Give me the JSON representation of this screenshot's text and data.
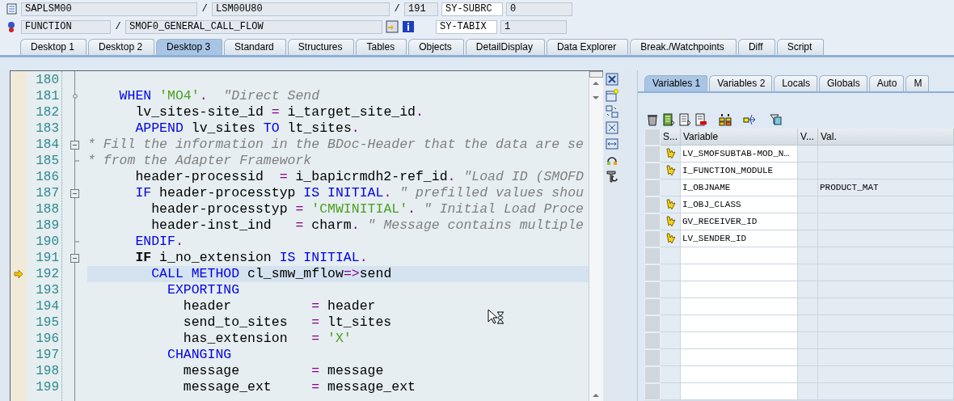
{
  "header": {
    "row_1": {
      "program": "SAPLSM00",
      "sep_1": "/",
      "include": "LSM00U80",
      "sep_2": "/",
      "line": "191",
      "sys_field": "SY-SUBRC",
      "sys_value": "0"
    },
    "row_2": {
      "type": "FUNCTION",
      "sep": "/",
      "name": "SMOF0_GENERAL_CALL_FLOW",
      "sys_field": "SY-TABIX",
      "sys_value": "1"
    }
  },
  "tabs": [
    {
      "label": "Desktop 1",
      "selected": false
    },
    {
      "label": "Desktop 2",
      "selected": false
    },
    {
      "label": "Desktop 3",
      "selected": true
    },
    {
      "label": "Standard",
      "selected": false
    },
    {
      "label": "Structures",
      "selected": false
    },
    {
      "label": "Tables",
      "selected": false
    },
    {
      "label": "Objects",
      "selected": false
    },
    {
      "label": "DetailDisplay",
      "selected": false
    },
    {
      "label": "Data Explorer",
      "selected": false
    },
    {
      "label": "Break./Watchpoints",
      "selected": false
    },
    {
      "label": "Diff",
      "selected": false
    },
    {
      "label": "Script",
      "selected": false
    }
  ],
  "editor": {
    "lines": [
      {
        "number": "180",
        "kind": "plain",
        "current": false
      },
      {
        "number": "181",
        "kind": "branch",
        "current": false,
        "tokens": [
          {
            "kind": "kw",
            "text": "    WHEN"
          },
          {
            "kind": "str",
            "text": " 'MO4'"
          },
          {
            "kind": "op",
            "text": "."
          },
          {
            "kind": "cmt",
            "text": "  \"Direct Send"
          }
        ]
      },
      {
        "number": "182",
        "kind": "plain",
        "current": false,
        "tokens": [
          {
            "kind": "plain",
            "text": "      lv_sites-site_id "
          },
          {
            "kind": "op",
            "text": "="
          },
          {
            "kind": "plain",
            "text": " i_target_site_id"
          },
          {
            "kind": "op",
            "text": "."
          }
        ]
      },
      {
        "number": "183",
        "kind": "plain",
        "current": false,
        "tokens": [
          {
            "kind": "kw",
            "text": "      APPEND"
          },
          {
            "kind": "plain",
            "text": " lv_sites "
          },
          {
            "kind": "kw",
            "text": "TO"
          },
          {
            "kind": "plain",
            "text": " lt_sites"
          },
          {
            "kind": "op",
            "text": "."
          }
        ]
      },
      {
        "number": "184",
        "kind": "block_start",
        "current": false,
        "tokens": [
          {
            "kind": "cmt",
            "text": "* Fill the information in the BDoc-Header that the data are se"
          }
        ]
      },
      {
        "number": "185",
        "kind": "block_end",
        "current": false,
        "tokens": [
          {
            "kind": "cmt",
            "text": "* from the Adapter Framework"
          }
        ]
      },
      {
        "number": "186",
        "kind": "plain",
        "current": false,
        "tokens": [
          {
            "kind": "plain",
            "text": "      header-processid  "
          },
          {
            "kind": "op",
            "text": "="
          },
          {
            "kind": "plain",
            "text": " i_bapicrmdh2-ref_id"
          },
          {
            "kind": "op",
            "text": "."
          },
          {
            "kind": "cmt",
            "text": " \"Load ID (SMOFD"
          }
        ]
      },
      {
        "number": "187",
        "kind": "block_start",
        "current": false,
        "tokens": [
          {
            "kind": "kw",
            "text": "      IF"
          },
          {
            "kind": "plain",
            "text": " header-processtyp "
          },
          {
            "kind": "kw",
            "text": "IS INITIAL"
          },
          {
            "kind": "op",
            "text": "."
          },
          {
            "kind": "cmt",
            "text": " \" prefilled values shou"
          }
        ]
      },
      {
        "number": "188",
        "kind": "plain",
        "current": false,
        "tokens": [
          {
            "kind": "plain",
            "text": "        header-processtyp "
          },
          {
            "kind": "op",
            "text": "="
          },
          {
            "kind": "str",
            "text": " 'CMWINITIAL'"
          },
          {
            "kind": "op",
            "text": "."
          },
          {
            "kind": "cmt",
            "text": " \" Initial Load Proce"
          }
        ]
      },
      {
        "number": "189",
        "kind": "plain",
        "current": false,
        "tokens": [
          {
            "kind": "plain",
            "text": "        header-inst_ind   "
          },
          {
            "kind": "op",
            "text": "="
          },
          {
            "kind": "plain",
            "text": " charm"
          },
          {
            "kind": "op",
            "text": "."
          },
          {
            "kind": "cmt",
            "text": " \" Message contains multiple"
          }
        ]
      },
      {
        "number": "190",
        "kind": "block_end",
        "current": false,
        "tokens": [
          {
            "kind": "kw",
            "text": "      ENDIF"
          },
          {
            "kind": "op",
            "text": "."
          }
        ]
      },
      {
        "number": "191",
        "kind": "block_start",
        "current": false,
        "tokens": [
          {
            "kind": "bold",
            "text": "      IF"
          },
          {
            "kind": "plain",
            "text": " i_no_extension "
          },
          {
            "kind": "kw",
            "text": "IS INITIAL"
          },
          {
            "kind": "op",
            "text": "."
          }
        ]
      },
      {
        "number": "192",
        "kind": "plain",
        "current": true,
        "tokens": [
          {
            "kind": "kw",
            "text": "        CALL METHOD"
          },
          {
            "kind": "plain",
            "text": " cl_smw_mflow"
          },
          {
            "kind": "op",
            "text": "=>"
          },
          {
            "kind": "plain",
            "text": "send"
          }
        ]
      },
      {
        "number": "193",
        "kind": "plain",
        "current": false,
        "tokens": [
          {
            "kind": "kw",
            "text": "          EXPORTING"
          }
        ]
      },
      {
        "number": "194",
        "kind": "plain",
        "current": false,
        "tokens": [
          {
            "kind": "plain",
            "text": "            header          "
          },
          {
            "kind": "op",
            "text": "="
          },
          {
            "kind": "plain",
            "text": " header"
          }
        ]
      },
      {
        "number": "195",
        "kind": "plain",
        "current": false,
        "tokens": [
          {
            "kind": "plain",
            "text": "            send_to_sites   "
          },
          {
            "kind": "op",
            "text": "="
          },
          {
            "kind": "plain",
            "text": " lt_sites"
          }
        ]
      },
      {
        "number": "196",
        "kind": "plain",
        "current": false,
        "tokens": [
          {
            "kind": "plain",
            "text": "            has_extension   "
          },
          {
            "kind": "op",
            "text": "="
          },
          {
            "kind": "str",
            "text": " 'X'"
          }
        ]
      },
      {
        "number": "197",
        "kind": "plain",
        "current": false,
        "tokens": [
          {
            "kind": "kw",
            "text": "          CHANGING"
          }
        ]
      },
      {
        "number": "198",
        "kind": "plain",
        "current": false,
        "tokens": [
          {
            "kind": "plain",
            "text": "            message         "
          },
          {
            "kind": "op",
            "text": "="
          },
          {
            "kind": "plain",
            "text": " message"
          }
        ]
      },
      {
        "number": "199",
        "kind": "plain",
        "current": false,
        "tokens": [
          {
            "kind": "plain",
            "text": "            message_ext     "
          },
          {
            "kind": "op",
            "text": "="
          },
          {
            "kind": "plain",
            "text": " message_ext"
          }
        ]
      }
    ]
  },
  "variables": {
    "tabs": [
      {
        "label": "Variables 1",
        "selected": true
      },
      {
        "label": "Variables 2",
        "selected": false
      },
      {
        "label": "Locals",
        "selected": false
      },
      {
        "label": "Globals",
        "selected": false
      },
      {
        "label": "Auto",
        "selected": false
      },
      {
        "label": "M",
        "selected": false
      }
    ],
    "columns": [
      "S...",
      "Variable",
      "V...",
      "Val."
    ],
    "rows": [
      {
        "changed": true,
        "variable": "LV_SMOFSUBTAB-MOD_N…"
      },
      {
        "changed": true,
        "variable": "I_FUNCTION_MODULE"
      },
      {
        "changed": false,
        "variable": "I_OBJNAME",
        "value": "PRODUCT_MAT"
      },
      {
        "changed": true,
        "variable": "I_OBJ_CLASS"
      },
      {
        "changed": true,
        "variable": "GV_RECEIVER_ID"
      },
      {
        "changed": true,
        "variable": "LV_SENDER_ID"
      }
    ]
  }
}
